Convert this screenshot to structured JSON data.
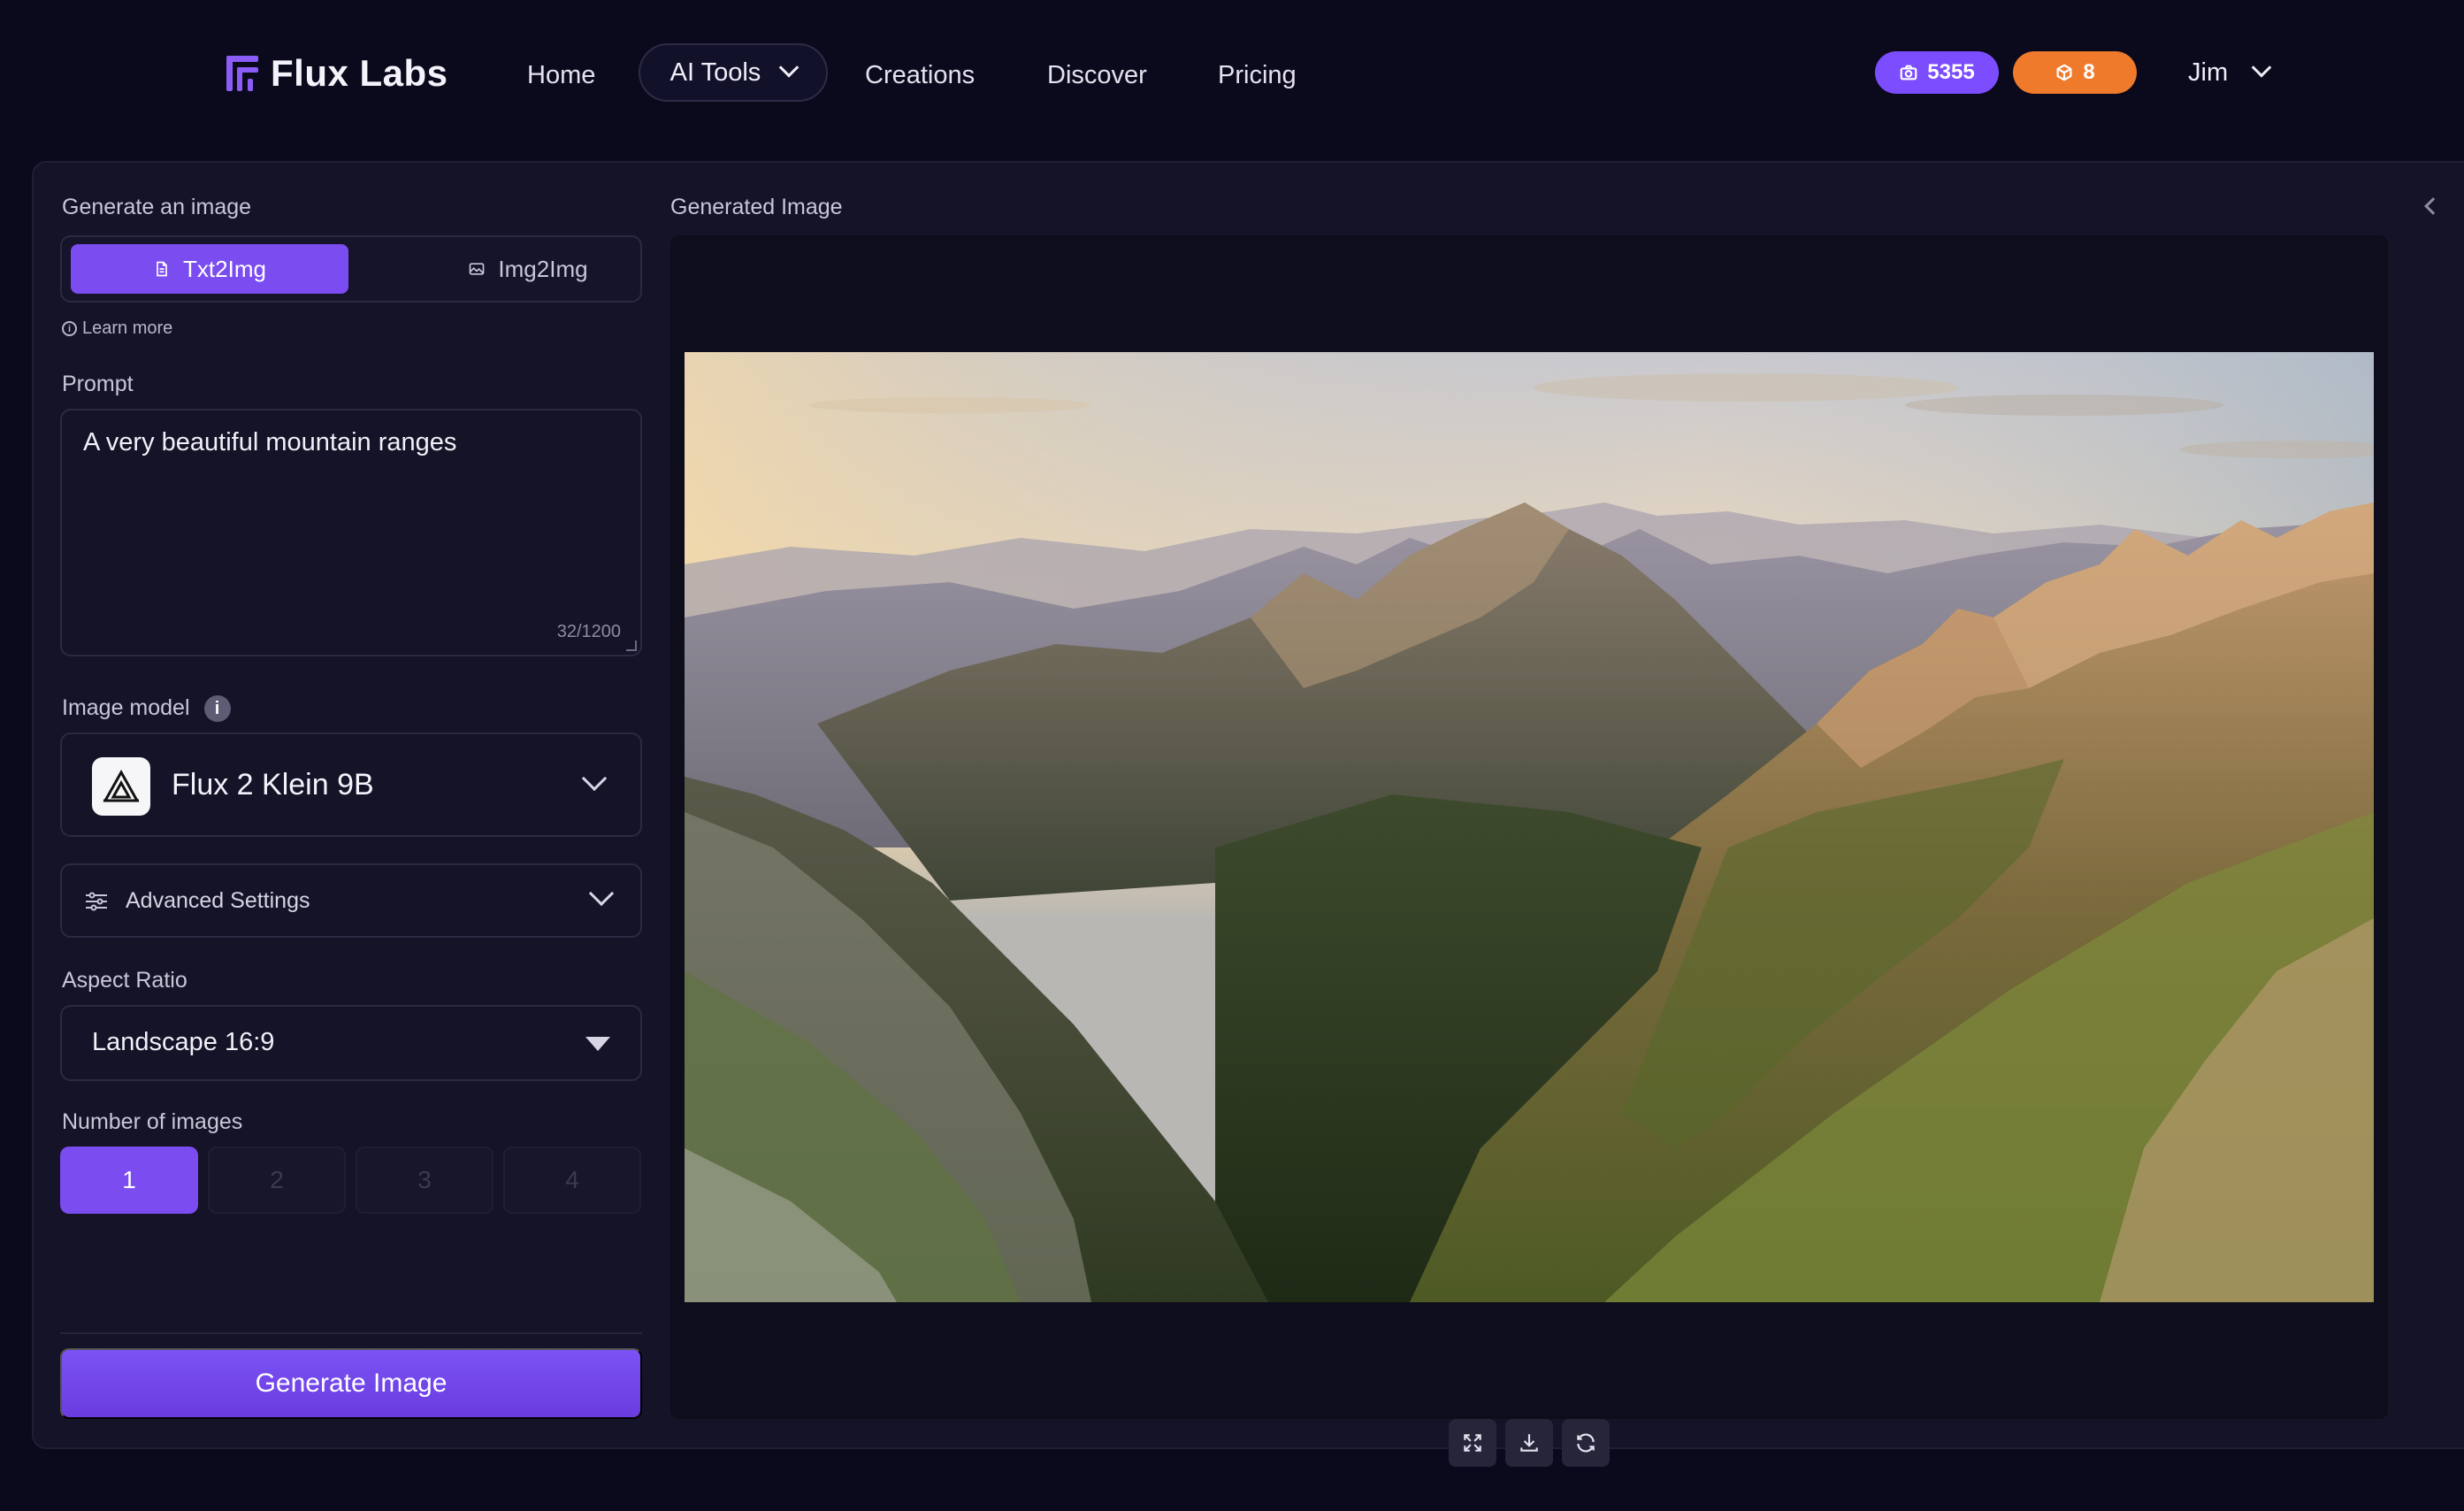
{
  "brand": {
    "name": "Flux Labs"
  },
  "nav": {
    "home": "Home",
    "ai_tools": "AI Tools",
    "creations": "Creations",
    "discover": "Discover",
    "pricing": "Pricing"
  },
  "account": {
    "credits": "5355",
    "gems": "8",
    "user": "Jim"
  },
  "form": {
    "title": "Generate an image",
    "tabs": [
      {
        "label": "Txt2Img",
        "active": true,
        "icon": "document-icon"
      },
      {
        "label": "Img2Img",
        "active": false,
        "icon": "image-icon"
      }
    ],
    "learn_more": "Learn more",
    "prompt_label": "Prompt",
    "prompt_value": "A very beautiful mountain ranges",
    "prompt_counter": "32/1200",
    "model_label": "Image model",
    "model_value": "Flux 2 Klein 9B",
    "advanced_label": "Advanced Settings",
    "aspect_label": "Aspect Ratio",
    "aspect_value": "Landscape 16:9",
    "count_label": "Number of images",
    "counts": [
      "1",
      "2",
      "3",
      "4"
    ],
    "count_selected": "1",
    "generate_label": "Generate Image"
  },
  "output": {
    "title": "Generated Image",
    "tools": [
      "expand-icon",
      "download-icon",
      "regenerate-icon"
    ]
  },
  "colors": {
    "accent": "#7b4cf0",
    "credits_badge": "#7c4dff",
    "gems_badge": "#f07a2c",
    "background": "#0b0a1c",
    "card": "#141328"
  }
}
